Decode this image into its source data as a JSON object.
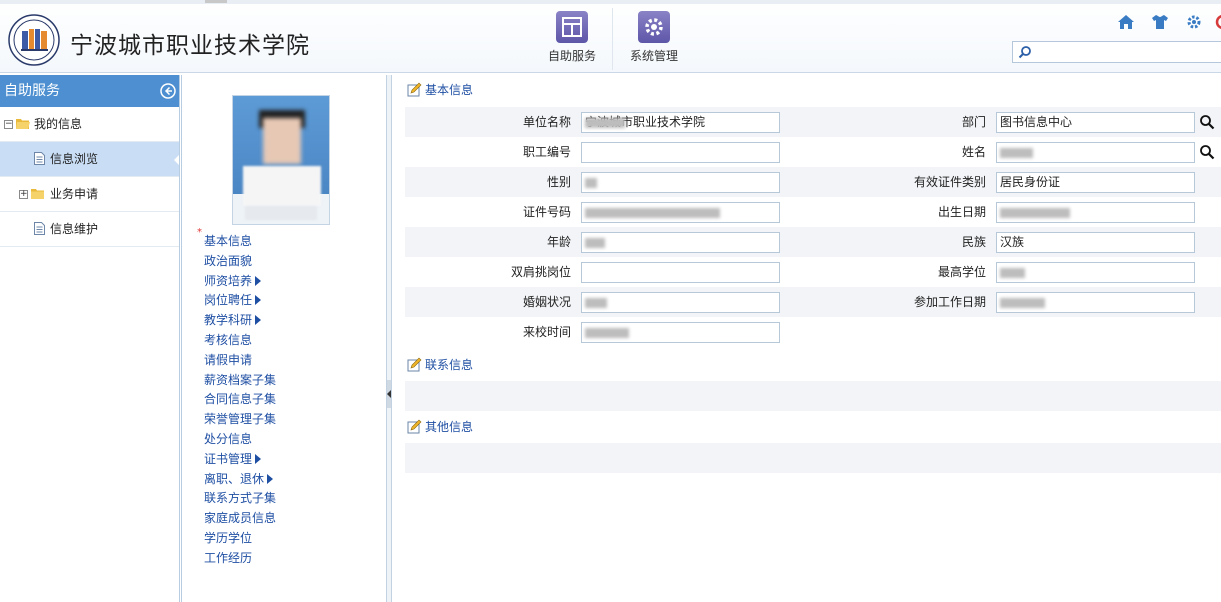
{
  "header": {
    "school_name": "宁波城市职业技术学院",
    "modules": [
      {
        "label": "自助服务"
      },
      {
        "label": "系统管理"
      }
    ],
    "search_placeholder": ""
  },
  "sidebar": {
    "title": "自助服务",
    "items": [
      {
        "label": "我的信息"
      },
      {
        "label": "信息浏览"
      },
      {
        "label": "业务申请"
      },
      {
        "label": "信息维护"
      }
    ]
  },
  "info_menu": {
    "items": [
      {
        "label": "基本信息",
        "required": true
      },
      {
        "label": "政治面貌"
      },
      {
        "label": "师资培养",
        "submenu": true
      },
      {
        "label": "岗位聘任",
        "submenu": true
      },
      {
        "label": "教学科研",
        "submenu": true
      },
      {
        "label": "考核信息"
      },
      {
        "label": "请假申请"
      },
      {
        "label": "薪资档案子集"
      },
      {
        "label": "合同信息子集"
      },
      {
        "label": "荣誉管理子集"
      },
      {
        "label": "处分信息"
      },
      {
        "label": "证书管理",
        "submenu": true
      },
      {
        "label": "离职、退休",
        "submenu": true
      },
      {
        "label": "联系方式子集"
      },
      {
        "label": "家庭成员信息"
      },
      {
        "label": "学历学位"
      },
      {
        "label": "工作经历"
      }
    ]
  },
  "basic": {
    "title": "基本信息",
    "rows": [
      {
        "left_label": "单位名称",
        "left_value": "宁波城市职业技术学院",
        "right_label": "部门",
        "right_value": "图书信息中心"
      },
      {
        "left_label": "职工编号",
        "left_value": "",
        "right_label": "姓名",
        "right_value": ""
      },
      {
        "left_label": "性别",
        "left_value": "",
        "right_label": "有效证件类别",
        "right_value": "居民身份证"
      },
      {
        "left_label": "证件号码",
        "left_value": "",
        "right_label": "出生日期",
        "right_value": ""
      },
      {
        "left_label": "年龄",
        "left_value": "",
        "right_label": "民族",
        "right_value": "汉族"
      },
      {
        "left_label": "双肩挑岗位",
        "left_value": "",
        "right_label": "最高学位",
        "right_value": ""
      },
      {
        "left_label": "婚姻状况",
        "left_value": "",
        "right_label": "参加工作日期",
        "right_value": ""
      },
      {
        "left_label": "来校时间",
        "left_value": ""
      }
    ]
  },
  "contact": {
    "title": "联系信息"
  },
  "other": {
    "title": "其他信息"
  }
}
